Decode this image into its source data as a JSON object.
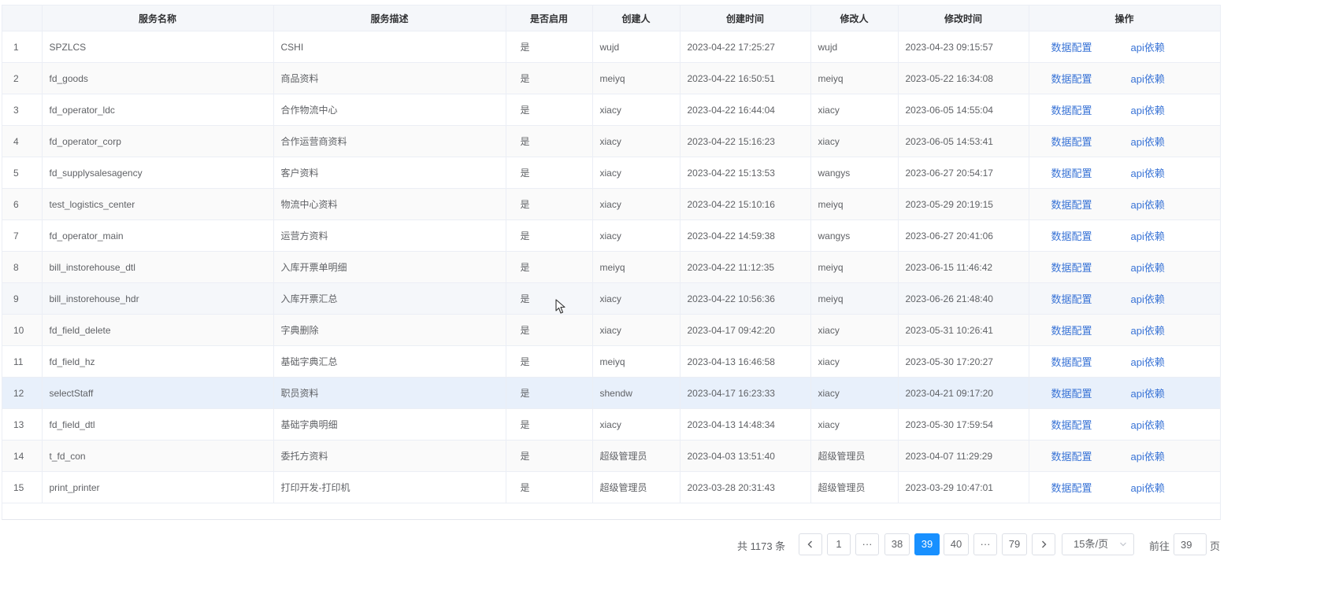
{
  "columns": {
    "index": "",
    "service_name": "服务名称",
    "service_desc": "服务描述",
    "enabled": "是否启用",
    "creator": "创建人",
    "created_time": "创建时间",
    "modifier": "修改人",
    "modified_time": "修改时间",
    "actions": "操作"
  },
  "action_labels": {
    "data_config": "数据配置",
    "api_dependency": "api依赖"
  },
  "rows": [
    {
      "index": "1",
      "name": "SPZLCS",
      "desc": "CSHI",
      "enabled": "是",
      "creator": "wujd",
      "created": "2023-04-22 17:25:27",
      "modifier": "wujd",
      "modified": "2023-04-23 09:15:57"
    },
    {
      "index": "2",
      "name": "fd_goods",
      "desc": "商品资料",
      "enabled": "是",
      "creator": "meiyq",
      "created": "2023-04-22 16:50:51",
      "modifier": "meiyq",
      "modified": "2023-05-22 16:34:08"
    },
    {
      "index": "3",
      "name": "fd_operator_ldc",
      "desc": "合作物流中心",
      "enabled": "是",
      "creator": "xiacy",
      "created": "2023-04-22 16:44:04",
      "modifier": "xiacy",
      "modified": "2023-06-05 14:55:04"
    },
    {
      "index": "4",
      "name": "fd_operator_corp",
      "desc": "合作运营商资料",
      "enabled": "是",
      "creator": "xiacy",
      "created": "2023-04-22 15:16:23",
      "modifier": "xiacy",
      "modified": "2023-06-05 14:53:41"
    },
    {
      "index": "5",
      "name": "fd_supplysalesagency",
      "desc": "客户资料",
      "enabled": "是",
      "creator": "xiacy",
      "created": "2023-04-22 15:13:53",
      "modifier": "wangys",
      "modified": "2023-06-27 20:54:17"
    },
    {
      "index": "6",
      "name": "test_logistics_center",
      "desc": "物流中心资料",
      "enabled": "是",
      "creator": "xiacy",
      "created": "2023-04-22 15:10:16",
      "modifier": "meiyq",
      "modified": "2023-05-29 20:19:15"
    },
    {
      "index": "7",
      "name": "fd_operator_main",
      "desc": "运营方资料",
      "enabled": "是",
      "creator": "xiacy",
      "created": "2023-04-22 14:59:38",
      "modifier": "wangys",
      "modified": "2023-06-27 20:41:06"
    },
    {
      "index": "8",
      "name": "bill_instorehouse_dtl",
      "desc": "入库开票单明细",
      "enabled": "是",
      "creator": "meiyq",
      "created": "2023-04-22 11:12:35",
      "modifier": "meiyq",
      "modified": "2023-06-15 11:46:42"
    },
    {
      "index": "9",
      "name": "bill_instorehouse_hdr",
      "desc": "入库开票汇总",
      "enabled": "是",
      "creator": "xiacy",
      "created": "2023-04-22 10:56:36",
      "modifier": "meiyq",
      "modified": "2023-06-26 21:48:40"
    },
    {
      "index": "10",
      "name": "fd_field_delete",
      "desc": "字典删除",
      "enabled": "是",
      "creator": "xiacy",
      "created": "2023-04-17 09:42:20",
      "modifier": "xiacy",
      "modified": "2023-05-31 10:26:41"
    },
    {
      "index": "11",
      "name": "fd_field_hz",
      "desc": "基础字典汇总",
      "enabled": "是",
      "creator": "meiyq",
      "created": "2023-04-13 16:46:58",
      "modifier": "xiacy",
      "modified": "2023-05-30 17:20:27"
    },
    {
      "index": "12",
      "name": "selectStaff",
      "desc": "职员资料",
      "enabled": "是",
      "creator": "shendw",
      "created": "2023-04-17 16:23:33",
      "modifier": "xiacy",
      "modified": "2023-04-21 09:17:20"
    },
    {
      "index": "13",
      "name": "fd_field_dtl",
      "desc": "基础字典明细",
      "enabled": "是",
      "creator": "xiacy",
      "created": "2023-04-13 14:48:34",
      "modifier": "xiacy",
      "modified": "2023-05-30 17:59:54"
    },
    {
      "index": "14",
      "name": "t_fd_con",
      "desc": "委托方资料",
      "enabled": "是",
      "creator": "超级管理员",
      "created": "2023-04-03 13:51:40",
      "modifier": "超级管理员",
      "modified": "2023-04-07 11:29:29"
    },
    {
      "index": "15",
      "name": "print_printer",
      "desc": "打印开发-打印机",
      "enabled": "是",
      "creator": "超级管理员",
      "created": "2023-03-28 20:31:43",
      "modifier": "超级管理员",
      "modified": "2023-03-29 10:47:01"
    }
  ],
  "pagination": {
    "total_text": "共 1173 条",
    "pages": [
      "1",
      "38",
      "39",
      "40",
      "79"
    ],
    "ellipsis": "···",
    "current_page": "39",
    "page_size_label": "15条/页",
    "goto_label": "前往",
    "goto_value": "39",
    "goto_suffix": "页"
  },
  "icons": {
    "prev": "chevron-left-icon",
    "next": "chevron-right-icon",
    "select": "chevron-down-icon",
    "cursor": "mouse-pointer-icon"
  }
}
